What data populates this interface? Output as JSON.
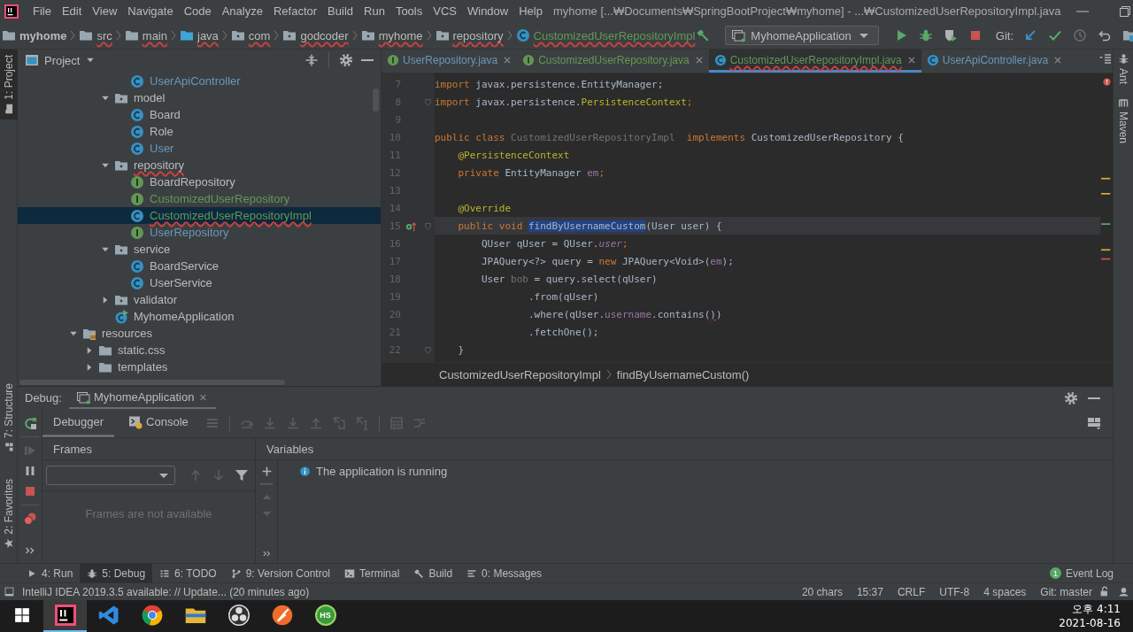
{
  "title_bar": {
    "menu": [
      "File",
      "Edit",
      "View",
      "Navigate",
      "Code",
      "Analyze",
      "Refactor",
      "Build",
      "Run",
      "Tools",
      "VCS",
      "Window",
      "Help"
    ],
    "title": "myhome [...₩Documents₩SpringBootProject₩myhome] - ...₩CustomizedUserRepositoryImpl.java"
  },
  "navigation_bar": {
    "crumbs": [
      {
        "label": "myhome",
        "kind": "module",
        "error": false
      },
      {
        "label": "src",
        "kind": "folder",
        "error": true
      },
      {
        "label": "main",
        "kind": "folder",
        "error": true
      },
      {
        "label": "java",
        "kind": "folder-blue",
        "error": true
      },
      {
        "label": "com",
        "kind": "package",
        "error": true
      },
      {
        "label": "godcoder",
        "kind": "package",
        "error": true
      },
      {
        "label": "myhome",
        "kind": "package",
        "error": true
      },
      {
        "label": "repository",
        "kind": "package",
        "error": true
      },
      {
        "label": "CustomizedUserRepositoryImpl",
        "kind": "class",
        "error": true
      }
    ],
    "run_configuration": "MyhomeApplication",
    "git_label": "Git:"
  },
  "left_stripe": [
    {
      "label": "1: Project",
      "kind": "project",
      "selected": true
    },
    {
      "label": "7: Structure",
      "kind": "structure",
      "selected": false
    },
    {
      "label": "2: Favorites",
      "kind": "favorites",
      "selected": false
    }
  ],
  "project_panel": {
    "title": "Project",
    "tree": [
      {
        "children": [
          {
            "children": [
              {
                "children": [
                  {
                    "label": "UserApiController",
                    "kind": "class",
                    "color": "#6897bb",
                    "error": false,
                    "selected": false
                  }
                ]
              },
              {
                "label": "model",
                "kind": "package",
                "color": "#bbbbbb",
                "error": false,
                "selected": false,
                "expanded": true,
                "children": [
                  {
                    "label": "Board",
                    "kind": "class",
                    "color": "#bbbbbb",
                    "error": false,
                    "selected": false
                  },
                  {
                    "label": "Role",
                    "kind": "class",
                    "color": "#bbbbbb",
                    "error": false,
                    "selected": false
                  },
                  {
                    "label": "User",
                    "kind": "class",
                    "color": "#6897bb",
                    "error": false,
                    "selected": false
                  }
                ]
              },
              {
                "label": "repository",
                "kind": "package",
                "color": "#bbbbbb",
                "error": true,
                "selected": false,
                "expanded": true,
                "children": [
                  {
                    "label": "BoardRepository",
                    "kind": "interface",
                    "color": "#bbbbbb",
                    "error": false,
                    "selected": false
                  },
                  {
                    "label": "CustomizedUserRepository",
                    "kind": "interface",
                    "color": "#629755",
                    "error": false,
                    "selected": false
                  },
                  {
                    "label": "CustomizedUserRepositoryImpl",
                    "kind": "class",
                    "color": "#629755",
                    "error": true,
                    "selected": true
                  },
                  {
                    "label": "UserRepository",
                    "kind": "interface",
                    "color": "#6897bb",
                    "error": false,
                    "selected": false
                  }
                ]
              },
              {
                "label": "service",
                "kind": "package",
                "color": "#bbbbbb",
                "error": false,
                "selected": false,
                "expanded": true,
                "children": [
                  {
                    "label": "BoardService",
                    "kind": "class",
                    "color": "#bbbbbb",
                    "error": false,
                    "selected": false
                  },
                  {
                    "label": "UserService",
                    "kind": "class",
                    "color": "#bbbbbb",
                    "error": false,
                    "selected": false
                  }
                ]
              },
              {
                "label": "validator",
                "kind": "package",
                "color": "#bbbbbb",
                "error": false,
                "selected": false,
                "expanded": false
              },
              {
                "label": "MyhomeApplication",
                "kind": "app",
                "color": "#bbbbbb",
                "error": false,
                "selected": false
              }
            ]
          }
        ]
      },
      {
        "label": "resources",
        "kind": "resources",
        "color": "#bbbbbb",
        "error": false,
        "selected": false,
        "expanded": true,
        "children": [
          {
            "label": "static.css",
            "kind": "folder",
            "color": "#bbbbbb",
            "error": false,
            "selected": false,
            "expanded": false
          },
          {
            "label": "templates",
            "kind": "folder",
            "color": "#bbbbbb",
            "error": false,
            "selected": false,
            "expanded": false
          }
        ]
      }
    ]
  },
  "editor": {
    "tabs": [
      {
        "label": "UserRepository.java",
        "kind": "interface",
        "color": "#6897bb",
        "error": false,
        "selected": false
      },
      {
        "label": "CustomizedUserRepository.java",
        "kind": "interface",
        "color": "#629755",
        "error": false,
        "selected": false
      },
      {
        "label": "CustomizedUserRepositoryImpl.java",
        "kind": "class",
        "color": "#629755",
        "error": true,
        "selected": true
      },
      {
        "label": "UserApiController.java",
        "kind": "class",
        "color": "#6897bb",
        "error": false,
        "selected": false
      }
    ],
    "lines": [
      {
        "number": "7",
        "tokens": [
          {
            "text": "import",
            "kind": "keyword"
          },
          {
            "text": " javax.persistence.EntityManager;",
            "kind": "plain"
          }
        ]
      },
      {
        "number": "8",
        "fold": true,
        "tokens": [
          {
            "text": "import",
            "kind": "keyword"
          },
          {
            "text": " javax.persistence.",
            "kind": "plain"
          },
          {
            "text": "PersistenceContext",
            "kind": "annotation"
          },
          {
            "text": ";",
            "kind": "keyword"
          }
        ]
      },
      {
        "number": "9"
      },
      {
        "number": "10",
        "tokens": [
          {
            "text": "public class ",
            "kind": "keyword"
          },
          {
            "text": "CustomizedUserRepositoryImpl",
            "kind": "unused"
          },
          {
            "text": "  implements ",
            "kind": "keyword"
          },
          {
            "text": "CustomizedUserRepository {",
            "kind": "plain"
          }
        ]
      },
      {
        "number": "11",
        "tokens": [
          {
            "text": "    @PersistenceContext",
            "kind": "annotation"
          }
        ]
      },
      {
        "number": "12",
        "tokens": [
          {
            "text": "    private ",
            "kind": "keyword"
          },
          {
            "text": "EntityManager ",
            "kind": "plain"
          },
          {
            "text": "em",
            "kind": "field"
          },
          {
            "text": ";",
            "kind": "keyword"
          }
        ]
      },
      {
        "number": "13"
      },
      {
        "number": "14",
        "tokens": [
          {
            "text": "    @Override",
            "kind": "annotation"
          }
        ]
      },
      {
        "number": "15",
        "fold": true,
        "override": true,
        "current": true,
        "tokens": [
          {
            "text": "    public void ",
            "kind": "keyword"
          },
          {
            "text": "findByUsernameCustom",
            "kind": "selection"
          },
          {
            "text": "(User user) {",
            "kind": "plain"
          }
        ]
      },
      {
        "number": "16",
        "tokens": [
          {
            "text": "        QUser qUser = QUser.",
            "kind": "plain"
          },
          {
            "text": "user",
            "kind": "static"
          },
          {
            "text": ";",
            "kind": "keyword"
          }
        ]
      },
      {
        "number": "17",
        "tokens": [
          {
            "text": "        JPAQuery<?> query = ",
            "kind": "plain"
          },
          {
            "text": "new ",
            "kind": "keyword"
          },
          {
            "text": "JPAQuery<Void>(",
            "kind": "plain"
          },
          {
            "text": "em",
            "kind": "field"
          },
          {
            "text": ");",
            "kind": "plain"
          }
        ]
      },
      {
        "number": "18",
        "tokens": [
          {
            "text": "        User ",
            "kind": "plain"
          },
          {
            "text": "bob",
            "kind": "unused"
          },
          {
            "text": " = query.select(qUser)",
            "kind": "plain"
          }
        ]
      },
      {
        "number": "19",
        "tokens": [
          {
            "text": "                .from(qUser)",
            "kind": "plain"
          }
        ]
      },
      {
        "number": "20",
        "tokens": [
          {
            "text": "                .where(qUser.",
            "kind": "plain"
          },
          {
            "text": "username",
            "kind": "field"
          },
          {
            "text": ".contains(",
            "kind": "plain"
          },
          {
            "text": ")",
            "kind": "error"
          },
          {
            "text": ")",
            "kind": "plain"
          }
        ]
      },
      {
        "number": "21",
        "tokens": [
          {
            "text": "                .fetchOne();",
            "kind": "plain"
          }
        ]
      },
      {
        "number": "22",
        "fold": true,
        "tokens": [
          {
            "text": "    }",
            "kind": "plain"
          }
        ]
      }
    ],
    "breadcrumbs": [
      "CustomizedUserRepositoryImpl",
      "findByUsernameCustom()"
    ]
  },
  "right_stripe": [
    "Ant",
    "Maven"
  ],
  "debug_panel": {
    "label": "Debug:",
    "session": "MyhomeApplication",
    "tabs": [
      {
        "label": "Debugger",
        "kind": "debugger",
        "selected": true
      },
      {
        "label": "Console",
        "kind": "console",
        "selected": false
      }
    ],
    "frames_title": "Frames",
    "frames_empty": "Frames are not available",
    "variables_title": "Variables",
    "message": "The application is running"
  },
  "tool_tabs": [
    {
      "label": "4: Run",
      "kind": "run",
      "selected": false
    },
    {
      "label": "5: Debug",
      "kind": "debug",
      "selected": true
    },
    {
      "label": "6: TODO",
      "kind": "todo",
      "selected": false
    },
    {
      "label": "9: Version Control",
      "kind": "vcs",
      "selected": false
    },
    {
      "label": "Terminal",
      "kind": "terminal",
      "selected": false
    },
    {
      "label": "Build",
      "kind": "build",
      "selected": false
    },
    {
      "label": "0: Messages",
      "kind": "messages",
      "selected": false
    }
  ],
  "event_log": {
    "label": "Event Log",
    "count": "1"
  },
  "status_bar": {
    "message": "IntelliJ IDEA 2019.3.5 available: // Update... (20 minutes ago)",
    "items": [
      "20 chars",
      "15:37",
      "CRLF",
      "UTF-8",
      "4 spaces",
      "Git: master"
    ]
  },
  "taskbar": {
    "apps": [
      {
        "kind": "start",
        "selected": false
      },
      {
        "kind": "ide",
        "selected": true
      },
      {
        "kind": "ribbon",
        "selected": false
      },
      {
        "kind": "browser",
        "selected": false
      },
      {
        "kind": "explorer",
        "selected": false
      },
      {
        "kind": "aperture",
        "selected": false
      },
      {
        "kind": "rocket",
        "selected": false
      },
      {
        "kind": "badge",
        "label": "HS",
        "selected": false
      }
    ],
    "time": "오후 4:11",
    "date": "2021-08-16"
  }
}
